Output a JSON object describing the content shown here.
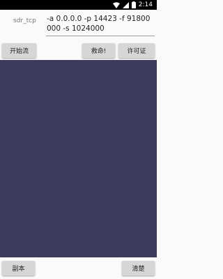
{
  "status_bar": {
    "time": "2:14",
    "icons": [
      "wifi-icon",
      "cellular-signal-icon",
      "battery-icon"
    ]
  },
  "form": {
    "label": "sdr_tcp",
    "args_value": "-a 0.0.0.0 -p 14423 -f 91800000 -s 1024000"
  },
  "toolbar": {
    "start_label": "开始流",
    "help_label": "救命!",
    "license_label": "许可证"
  },
  "footer": {
    "copy_label": "副本",
    "clear_label": "清楚"
  },
  "colors": {
    "output_background": "#3d3a5c",
    "button_background": "#d6d6d6",
    "status_bar": "#000000"
  }
}
